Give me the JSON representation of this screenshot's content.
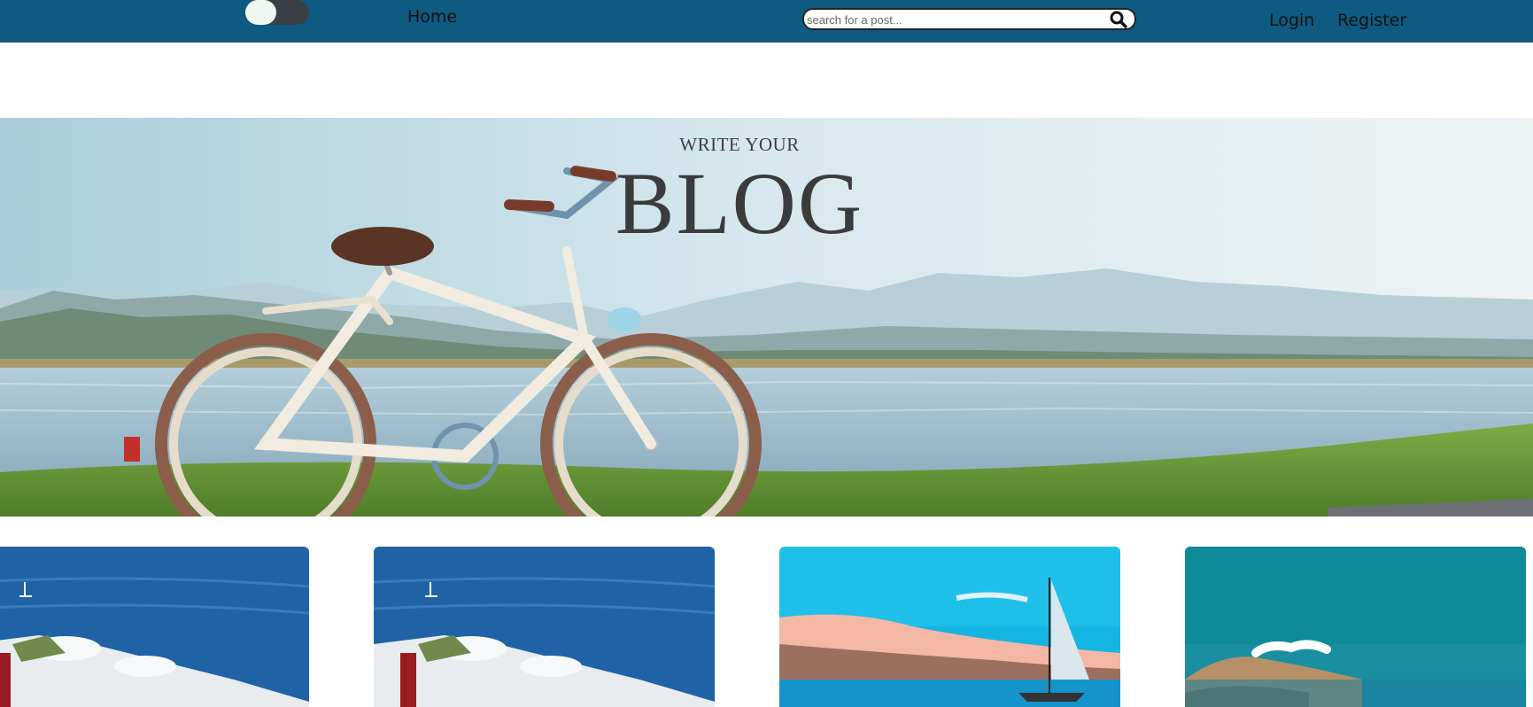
{
  "nav": {
    "theme_toggle": "theme-toggle",
    "home_label": "Home",
    "search_placeholder": "search for a post...",
    "login_label": "Login",
    "register_label": "Register"
  },
  "hero": {
    "kicker": "WRITE YOUR",
    "title": "BLOG"
  },
  "colors": {
    "navbar": "#0e5a80",
    "hero_text": "#3b3b3b"
  },
  "posts": [
    {
      "image": "santorini-sea-view"
    },
    {
      "image": "santorini-sea-view"
    },
    {
      "image": "sailboat-on-sea"
    },
    {
      "image": "coastline-teal-sea"
    }
  ]
}
